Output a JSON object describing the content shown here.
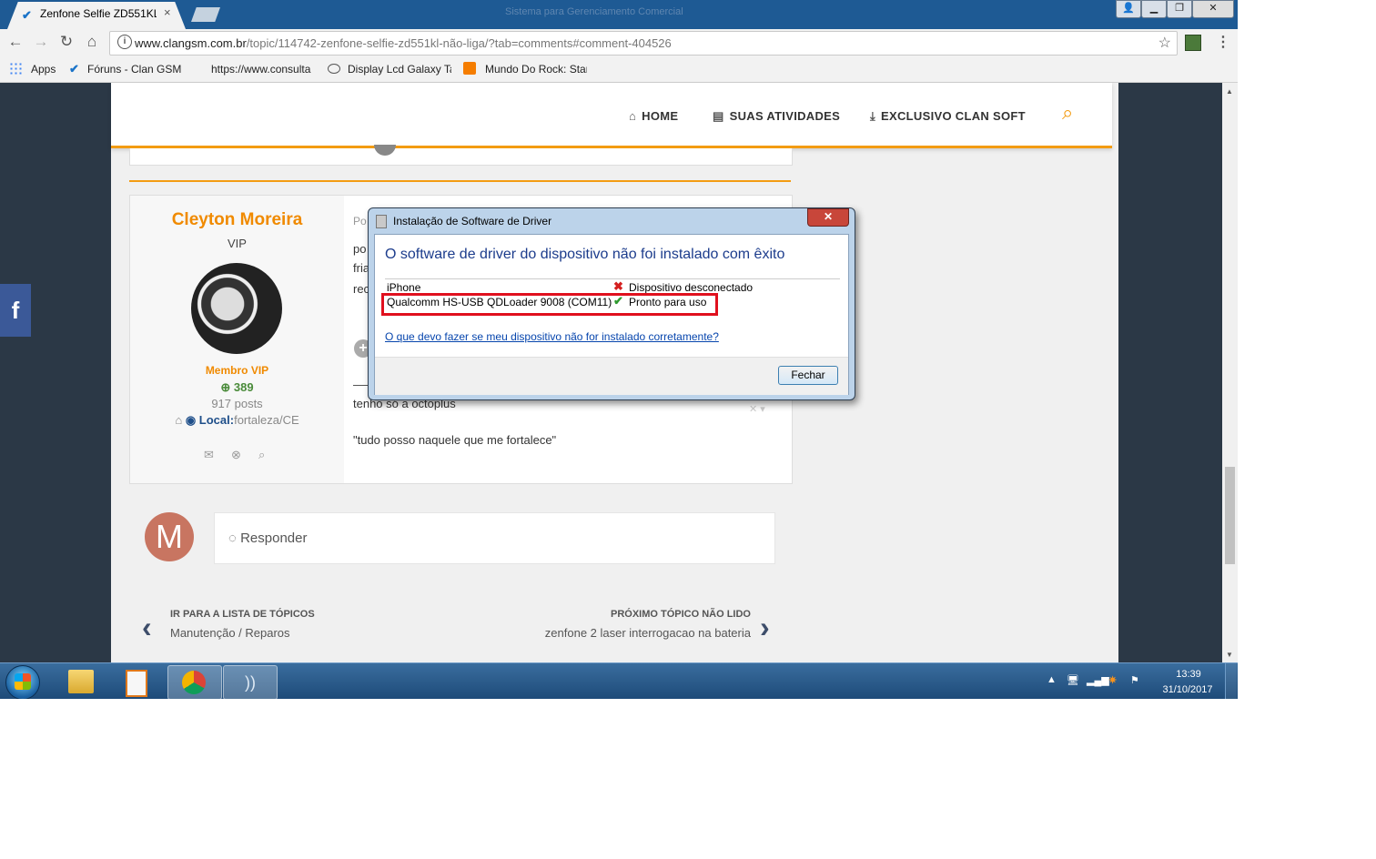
{
  "browser": {
    "tab_title": "Zenfone Selfie ZD551KL",
    "background_title": "Sistema para Gerenciamento Comercial",
    "url_host": "www.clangsm.com.br",
    "url_path": "/topic/114742-zenfone-selfie-zd551kl-não-liga/?tab=comments#comment-404526",
    "bookmarks": [
      "Apps",
      "Fóruns - Clan GSM",
      "https://www.consulta",
      "Display Lcd Galaxy Ta",
      "Mundo Do Rock: Star"
    ]
  },
  "site": {
    "nav": [
      "HOME",
      "SUAS ATIVIDADES",
      "EXCLUSIVO CLAN SOFT"
    ],
    "facebook_glyph": "f"
  },
  "post": {
    "author": "Cleyton Moreira",
    "role": "VIP",
    "group": "Membro VIP",
    "reputation": "389",
    "posts": "917 posts",
    "local_label": "Local:",
    "local_value": "fortaleza/CE",
    "body_lines": [
      "Po",
      "po",
      "fria",
      "rec"
    ],
    "signature1": "tenho só a octoplus",
    "signature2": "\"tudo posso naquele que me fortalece\""
  },
  "reply": {
    "avatar_letter": "M",
    "placeholder": "Responder"
  },
  "topic_nav": {
    "prev_caption": "IR PARA A LISTA DE TÓPICOS",
    "prev_link": "Manutenção / Reparos",
    "next_caption": "PRÓXIMO TÓPICO NÃO LIDO",
    "next_link": "zenfone 2 laser interrogacao na bateria"
  },
  "dialog": {
    "title": "Instalação de Software de Driver",
    "heading": "O software de driver do dispositivo não foi instalado com êxito",
    "devices": [
      {
        "name": "iPhone",
        "status": "Dispositivo desconectado",
        "icon": "error-x-icon",
        "color": "#d42020"
      },
      {
        "name": "Qualcomm HS-USB QDLoader 9008 (COM11)",
        "status": "Pronto para uso",
        "icon": "check-icon",
        "color": "#2e9a2e"
      }
    ],
    "help_link": "O que devo fazer se meu dispositivo não for instalado corretamente?",
    "close_button": "Fechar"
  },
  "taskbar": {
    "time": "13:39",
    "date": "31/10/2017"
  },
  "colors": {
    "accent_orange": "#f39c12",
    "taskbar_blue": "#1d4a78",
    "highlight_red": "#e0101e"
  }
}
